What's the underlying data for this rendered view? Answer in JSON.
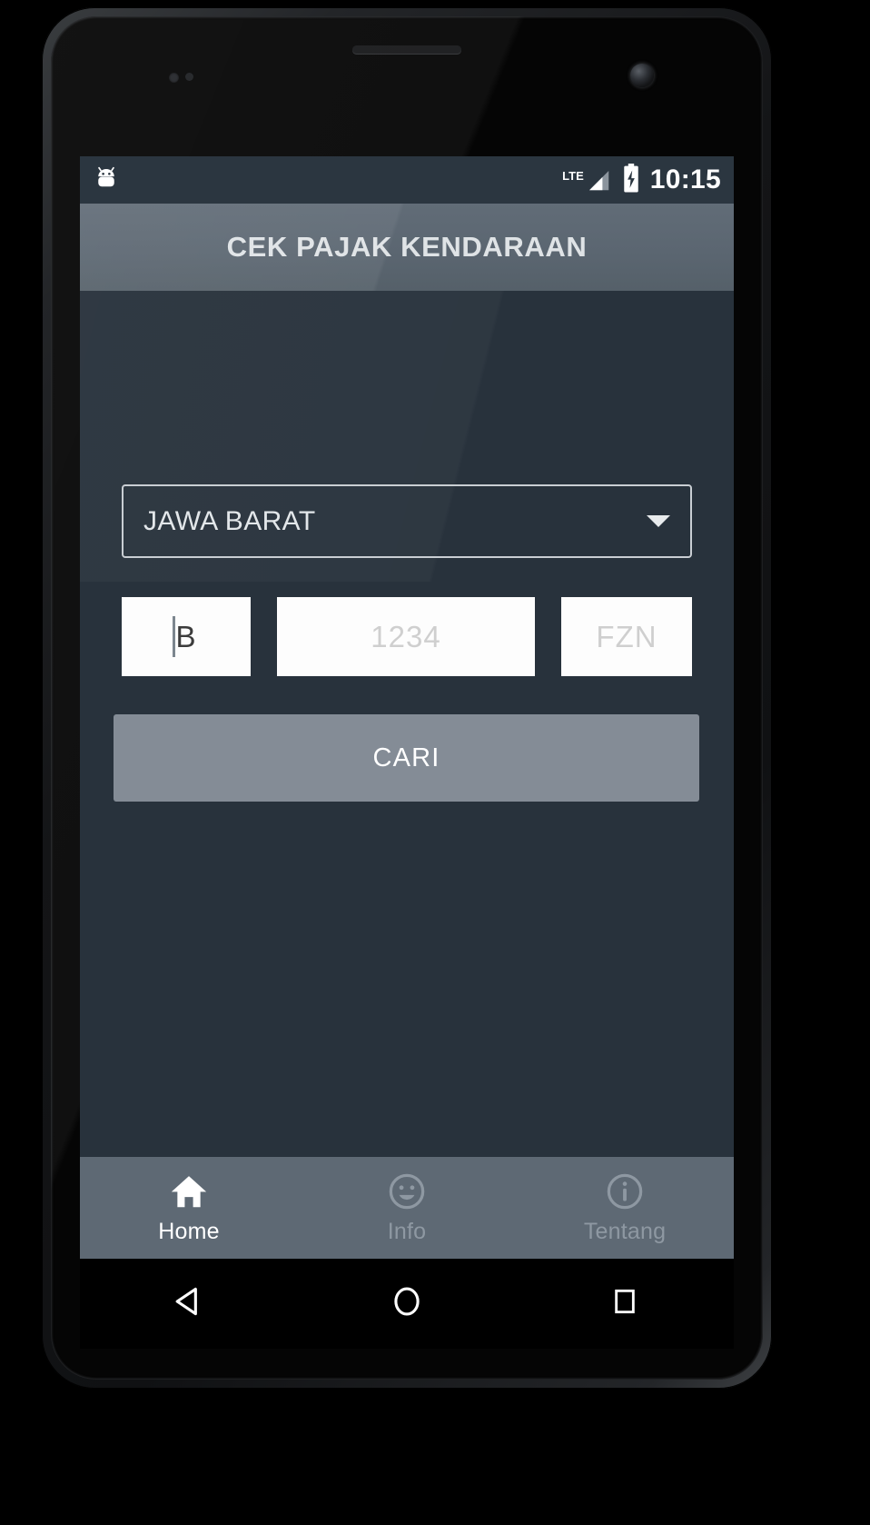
{
  "status_bar": {
    "notification_icon": "android-head-icon",
    "network_label": "LTE",
    "signal_icon": "signal-bars-icon",
    "battery_icon": "battery-charging-icon",
    "time": "10:15"
  },
  "action_bar": {
    "title": "CEK PAJAK KENDARAAN"
  },
  "form": {
    "province_spinner": {
      "name": "province-spinner",
      "value": "JAWA BARAT",
      "caret_icon": "chevron-down-icon"
    },
    "plate_prefix": {
      "value": "B",
      "placeholder": "B"
    },
    "plate_number": {
      "value": "",
      "placeholder": "1234"
    },
    "plate_suffix": {
      "value": "",
      "placeholder": "FZN"
    },
    "submit_button": {
      "label": "CARI"
    }
  },
  "tab_bar": {
    "tabs": [
      {
        "label": "Home",
        "icon": "home-icon",
        "active": true
      },
      {
        "label": "Info",
        "icon": "smiley-face-icon",
        "active": false
      },
      {
        "label": "Tentang",
        "icon": "info-circle-icon",
        "active": false
      }
    ]
  },
  "system_nav": {
    "back": "back-triangle-icon",
    "home": "home-circle-icon",
    "recents": "recents-square-icon"
  },
  "colors": {
    "status_bar_bg": "#2b3640",
    "action_bar_bg": "#5b6671",
    "content_bg": "#28323c",
    "button_bg": "#848c96",
    "tab_bar_bg": "#5e6974",
    "field_bg": "#fdfdfd",
    "accent_text": "#dfe3e6"
  }
}
